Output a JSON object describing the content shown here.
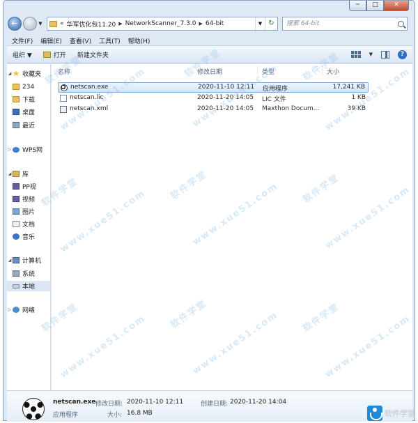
{
  "window": {
    "caption": {
      "minimize": "─",
      "maximize": "□",
      "close": "✕"
    }
  },
  "address": {
    "back": "←",
    "crumbs": [
      "«",
      "华军优化包11.20",
      "NetworkScanner_7.3.0",
      "64-bit"
    ],
    "refresh": "↻",
    "dropdown": "▼"
  },
  "search": {
    "placeholder": "搜索 64-bit"
  },
  "menu": [
    "文件(F)",
    "编辑(E)",
    "查看(V)",
    "工具(T)",
    "帮助(H)"
  ],
  "toolbar": {
    "organize": "组织 ▼",
    "open": "打开",
    "new_folder": "新建文件夹",
    "view_caret": "▼",
    "help": "?"
  },
  "navpane": {
    "items": [
      {
        "label": "收藏夹",
        "icon": "star-icon"
      },
      {
        "label": "234",
        "icon": "folder-icon"
      },
      {
        "label": "下载",
        "icon": "download-folder-icon"
      },
      {
        "label": "桌面",
        "icon": "desktop-icon"
      },
      {
        "label": "最近",
        "icon": "recent-places-icon"
      },
      {
        "label": "WPS网",
        "icon": "wps-cloud-icon"
      },
      {
        "label": "库",
        "icon": "library-icon"
      },
      {
        "label": "PP视",
        "icon": "pp-video-icon"
      },
      {
        "label": "视频",
        "icon": "video-library-icon"
      },
      {
        "label": "图片",
        "icon": "pictures-library-icon"
      },
      {
        "label": "文档",
        "icon": "documents-library-icon"
      },
      {
        "label": "音乐",
        "icon": "music-library-icon"
      },
      {
        "label": "计算机",
        "icon": "computer-icon"
      },
      {
        "label": "系统",
        "icon": "system-drive-icon"
      },
      {
        "label": "本地",
        "icon": "local-disk-icon"
      },
      {
        "label": "网络",
        "icon": "network-icon"
      }
    ]
  },
  "columns": {
    "name": "名称",
    "modified": "修改日期",
    "type": "类型",
    "size": "大小"
  },
  "files": [
    {
      "name": "netscan.exe",
      "modified": "2020-11-10 12:11",
      "type": "应用程序",
      "size": "17,241 KB"
    },
    {
      "name": "netscan.lic",
      "modified": "2020-11-20 14:05",
      "type": "LIC 文件",
      "size": "1 KB"
    },
    {
      "name": "netscan.xml",
      "modified": "2020-11-20 14:05",
      "type": "Maxthon Docum...",
      "size": "39 KB"
    }
  ],
  "details": {
    "file_name": "netscan.exe",
    "modified_label": "修改日期:",
    "modified_value": "2020-11-10 12:11",
    "created_label": "创建日期:",
    "created_value": "2020-11-20 14:04",
    "type_value": "应用程序",
    "size_label": "大小:",
    "size_value": "16.8 MB"
  },
  "watermark": {
    "cn": "软件学堂",
    "url": "www.xue51.com"
  },
  "logo": {
    "text": "软件学堂"
  }
}
